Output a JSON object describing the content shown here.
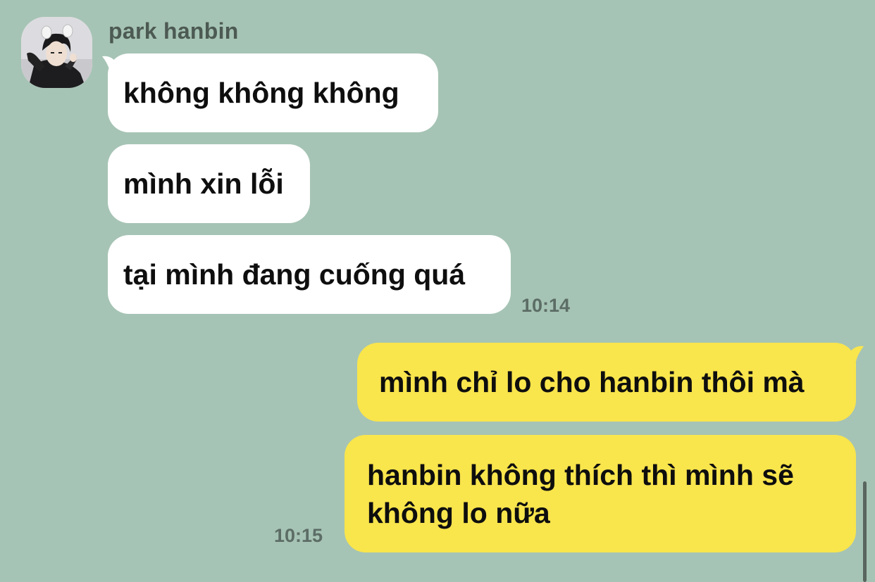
{
  "chat": {
    "sender": {
      "name": "park hanbin",
      "avatar_icon": "profile-photo"
    },
    "incoming": [
      {
        "text": "không không không"
      },
      {
        "text": "mình xin lỗi"
      },
      {
        "text": "tại mình đang cuống quá"
      }
    ],
    "incoming_time": "10:14",
    "outgoing": [
      {
        "text": "mình chỉ lo cho hanbin thôi mà"
      },
      {
        "text": "hanbin không thích thì mình sẽ không lo nữa"
      }
    ],
    "outgoing_time": "10:15",
    "colors": {
      "background": "#a6c4b5",
      "incoming_bubble": "#ffffff",
      "outgoing_bubble": "#f9e54c",
      "meta_text": "#5c6d66"
    }
  }
}
